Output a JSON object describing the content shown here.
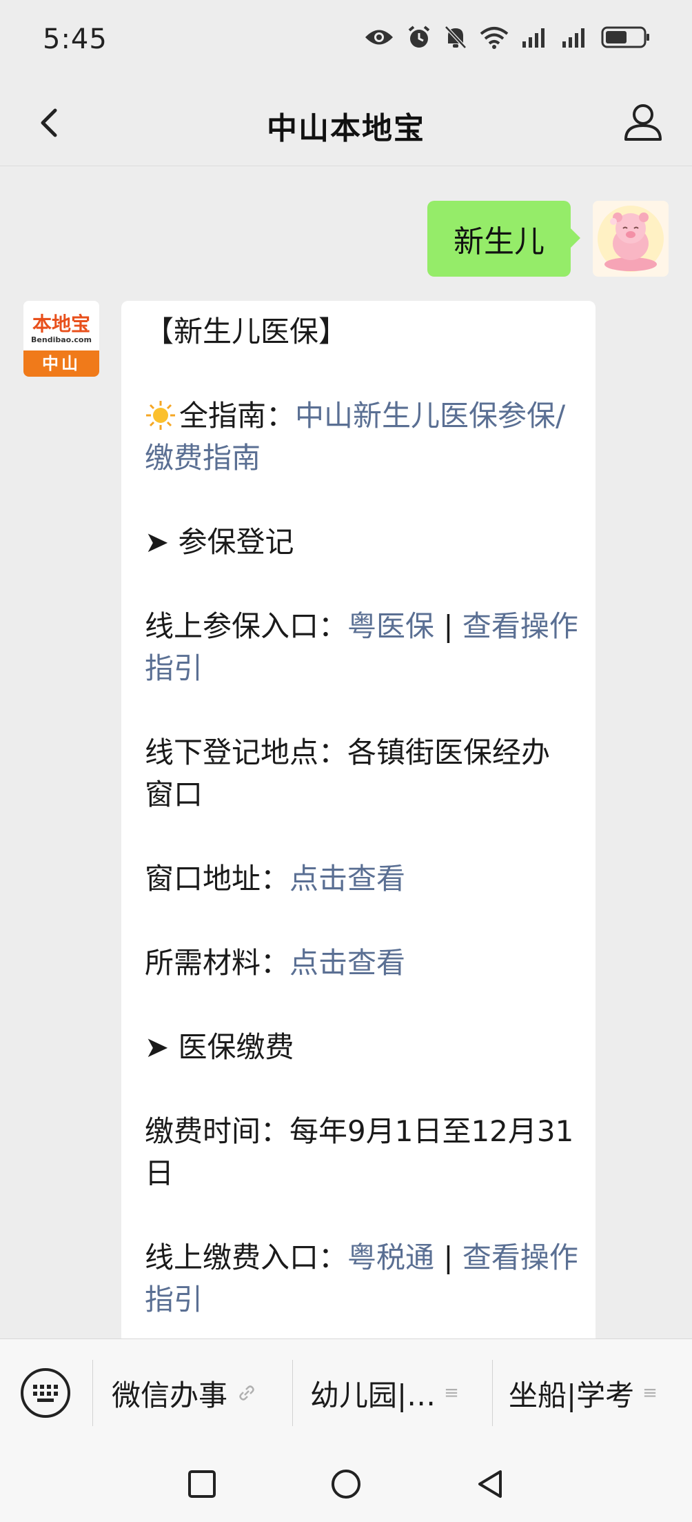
{
  "status_bar": {
    "time": "5:45",
    "icons": [
      "eye-icon",
      "alarm-icon",
      "bell-muted-icon",
      "wifi-icon",
      "signal-icon",
      "signal-icon",
      "battery-icon"
    ]
  },
  "header": {
    "title": "中山本地宝",
    "back_icon": "chevron-left-icon",
    "profile_icon": "person-icon"
  },
  "chat": {
    "outgoing": {
      "text": "新生儿"
    },
    "bot_avatar": {
      "logo_text": "本地宝",
      "sub_text": "Bendibao.com",
      "city": "中山"
    },
    "incoming": {
      "title": "【新生儿医保】",
      "guide_label": "全指南：",
      "guide_link": "中山新生儿医保参保/缴费指南",
      "section1": "➤ 参保登记",
      "online_reg_label": "线上参保入口：",
      "online_reg_link1": "粤医保",
      "online_reg_sep": " | ",
      "online_reg_link2": "查看操作指引",
      "offline_label": "线下登记地点：",
      "offline_value": "各镇街医保经办窗口",
      "window_label": "窗口地址：",
      "window_link": "点击查看",
      "materials_label": "所需材料：",
      "materials_link": "点击查看",
      "section2": "➤ 医保缴费",
      "pay_time_label": "缴费时间：",
      "pay_time_value": "每年9月1日至12月31日",
      "online_pay_label": "线上缴费入口：",
      "online_pay_link1": "粤税通",
      "online_pay_sep": " | ",
      "online_pay_link2": "查看操作指引"
    }
  },
  "menu": {
    "keyboard_icon": "keyboard-icon",
    "items": [
      {
        "label": "微信办事",
        "icon": "link-icon"
      },
      {
        "label": "幼儿园|…",
        "icon": "menu-lines-icon"
      },
      {
        "label": "坐船|学考",
        "icon": "menu-lines-icon"
      }
    ]
  },
  "nav": {
    "icons": [
      "recent-apps-icon",
      "home-icon",
      "back-icon"
    ]
  },
  "colors": {
    "background": "#ededed",
    "outgoing_bubble": "#95ec69",
    "link": "#5a6f93",
    "brand_orange": "#f07a1a"
  }
}
